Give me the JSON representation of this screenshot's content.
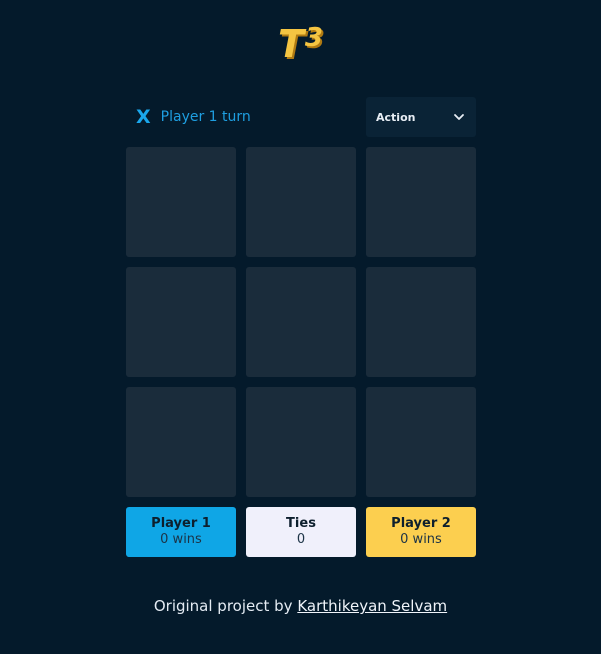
{
  "logo": {
    "text": "T",
    "superscript": "3",
    "color": "#f5c542"
  },
  "turn": {
    "mark": "X",
    "label": "Player 1 turn"
  },
  "action_menu": {
    "label": "Action",
    "icon": "chevron-down-icon"
  },
  "board": {
    "cells": [
      "",
      "",
      "",
      "",
      "",
      "",
      "",
      "",
      ""
    ]
  },
  "scores": {
    "player1": {
      "name": "Player 1",
      "value": "0 wins",
      "color": "#0fa6e6"
    },
    "ties": {
      "name": "Ties",
      "value": "0",
      "color": "#f0f0fb"
    },
    "player2": {
      "name": "Player 2",
      "value": "0 wins",
      "color": "#fccf4f"
    }
  },
  "footer": {
    "prefix": "Original project by",
    "link_text": "Karthikeyan Selvam"
  },
  "colors": {
    "background": "#041a2b",
    "cell": "#1a2c3b",
    "accent": "#1e9ee0"
  }
}
